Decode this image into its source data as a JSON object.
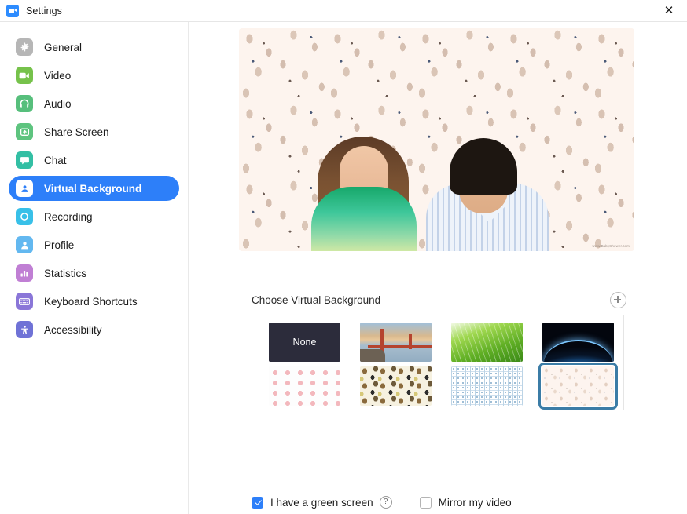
{
  "window": {
    "title": "Settings",
    "app_icon": "zoom-camera-icon",
    "close_label": "✕"
  },
  "sidebar": {
    "items": [
      {
        "label": "General",
        "icon": "gear-icon",
        "color": "#b6b6b6",
        "active": false
      },
      {
        "label": "Video",
        "icon": "camera-icon",
        "color": "#76c24b",
        "active": false
      },
      {
        "label": "Audio",
        "icon": "headphones-icon",
        "color": "#57bf7c",
        "active": false
      },
      {
        "label": "Share Screen",
        "icon": "share-screen-icon",
        "color": "#5ec47f",
        "active": false
      },
      {
        "label": "Chat",
        "icon": "chat-bubble-icon",
        "color": "#33bfa4",
        "active": false
      },
      {
        "label": "Virtual Background",
        "icon": "virtual-background-icon",
        "color": "#ffffff",
        "active": true
      },
      {
        "label": "Recording",
        "icon": "record-circle-icon",
        "color": "#38c0e8",
        "active": false
      },
      {
        "label": "Profile",
        "icon": "person-icon",
        "color": "#63b8f0",
        "active": false
      },
      {
        "label": "Statistics",
        "icon": "bar-chart-icon",
        "color": "#c07fd4",
        "active": false
      },
      {
        "label": "Keyboard Shortcuts",
        "icon": "keyboard-icon",
        "color": "#8a76d8",
        "active": false
      },
      {
        "label": "Accessibility",
        "icon": "accessibility-icon",
        "color": "#6f72d6",
        "active": false
      }
    ],
    "active_accent": "#2d7ff9"
  },
  "preview": {
    "alt": "video-preview-with-virtual-background",
    "watermark": "www.BabyShower.com"
  },
  "choose_section": {
    "label": "Choose Virtual Background",
    "add_button": "add-background-button"
  },
  "backgrounds": {
    "rows": [
      [
        {
          "name": "None",
          "label": "None",
          "kind": "none",
          "selected": false
        },
        {
          "name": "Golden Gate Bridge",
          "label": "",
          "kind": "bridge",
          "selected": false
        },
        {
          "name": "Grass",
          "label": "",
          "kind": "grass",
          "selected": false
        },
        {
          "name": "Earth from Space",
          "label": "",
          "kind": "earth",
          "selected": false
        }
      ],
      [
        {
          "name": "Baby Pattern",
          "label": "",
          "kind": "babies",
          "selected": false
        },
        {
          "name": "Jungle Pattern",
          "label": "",
          "kind": "jungle",
          "selected": false
        },
        {
          "name": "Blue Dots Pattern",
          "label": "",
          "kind": "dots",
          "selected": false
        },
        {
          "name": "Bunny Pattern",
          "label": "",
          "kind": "bunny",
          "selected": true
        }
      ]
    ],
    "selected_border_color": "#3b7ca6"
  },
  "options": {
    "green_screen": {
      "label": "I have a green screen",
      "checked": true
    },
    "help": "?",
    "mirror": {
      "label": "Mirror my video",
      "checked": false
    }
  }
}
